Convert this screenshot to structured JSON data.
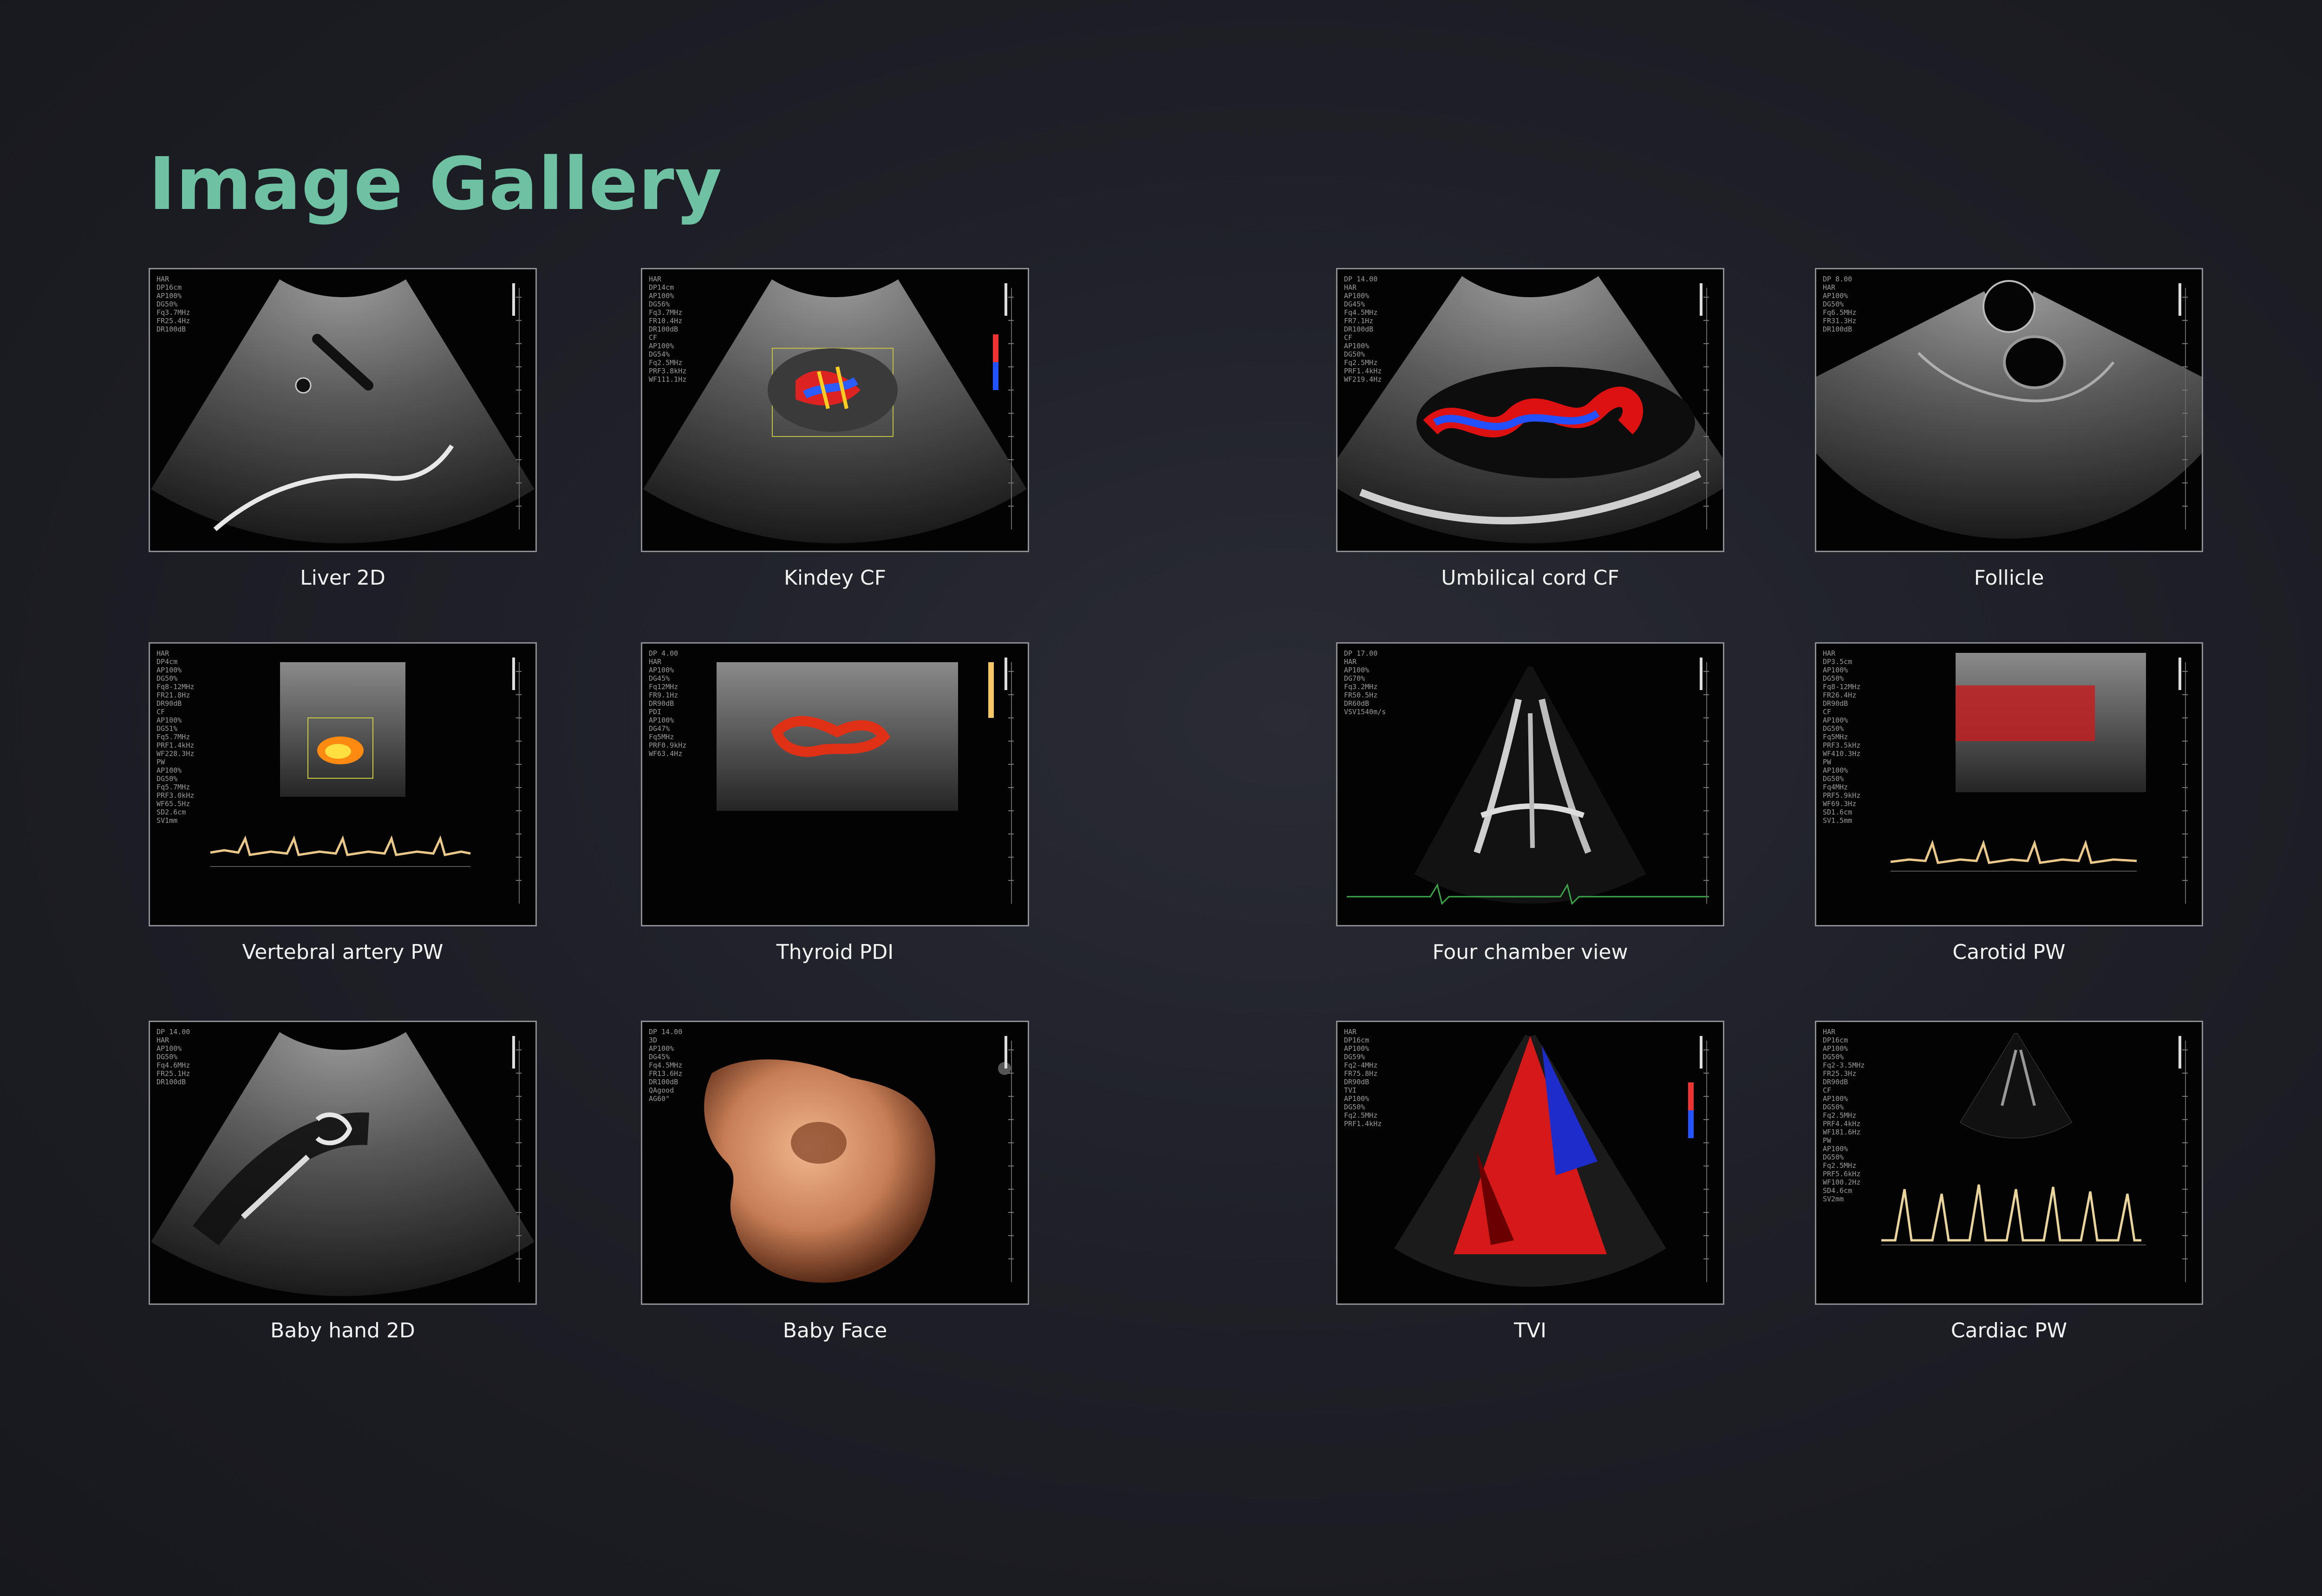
{
  "title": "Image Gallery",
  "colors": {
    "title": "#6fc1a3",
    "background": "#1f2027",
    "frame_border": "#8d8e93",
    "caption": "#f2f2f2"
  },
  "gallery": [
    {
      "caption": "Liver 2D",
      "params": "HAR\nDP16cm\nAP100%\nDG50%\nFq3.7MHz\nFR25.4Hz\nDR100dB",
      "kind": "sector-liver"
    },
    {
      "caption": "Kindey CF",
      "params": "HAR\nDP14cm\nAP100%\nDG56%\nFq3.7MHz\nFR10.4Hz\nDR100dB\nCF\nAP100%\nDG54%\nFq2.5MHz\nPRF3.8kHz\nWF111.1Hz",
      "kind": "sector-color"
    },
    {
      "caption": "Umbilical cord CF",
      "params": "DP 14.00\nHAR\nAP100%\nDG45%\nFq4.5MHz\nFR7.1Hz\nDR100dB\nCF\nAP100%\nDG50%\nFq2.5MHz\nPRF1.4kHz\nWF219.4Hz",
      "kind": "sector-cord"
    },
    {
      "caption": "Follicle",
      "params": "DP 8.00\nHAR\nAP100%\nDG50%\nFq6.5MHz\nFR31.3Hz\nDR100dB",
      "kind": "follicle"
    },
    {
      "caption": "Vertebral artery PW",
      "params": "HAR\nDP4cm\nAP100%\nDG50%\nFq8-12MHz\nFR21.8Hz\nDR90dB\nCF\nAP100%\nDG51%\nFq5.7MHz\nPRF1.4kHz\nWF228.3Hz\nPW\nAP100%\nDG50%\nFq5.7MHz\nPRF3.0kHz\nWF65.5Hz\nSD2.6cm\nSV1mm",
      "kind": "pw-linear"
    },
    {
      "caption": "Thyroid PDI",
      "params": "DP 4.00\nHAR\nAP100%\nDG45%\nFq12MHz\nFR9.1Hz\nDR90dB\nPDI\nAP100%\nDG47%\nFq5MHz\nPRF0.9kHz\nWF63.4Hz",
      "kind": "thyroid"
    },
    {
      "caption": "Four chamber view",
      "params": "DP 17.00\nHAR\nAP100%\nDG70%\nFq3.2MHz\nFR50.5Hz\nDR60dB\nVSV1540m/s",
      "kind": "cardiac"
    },
    {
      "caption": "Carotid PW",
      "params": "HAR\nDP3.5cm\nAP100%\nDG50%\nFq8-12MHz\nFR26.4Hz\nDR90dB\nCF\nAP100%\nDG50%\nFq5MHz\nPRF3.5kHz\nWF410.3Hz\nPW\nAP100%\nDG50%\nFq4MHz\nPRF5.9kHz\nWF69.3Hz\nSD1.6cm\nSV1.5mm",
      "kind": "pw-carotid"
    },
    {
      "caption": "Baby hand 2D",
      "params": "DP 14.00\nHAR\nAP100%\nDG50%\nFq4.6MHz\nFR25.1Hz\nDR100dB",
      "kind": "sector-hand"
    },
    {
      "caption": "Baby Face",
      "params": "DP 14.00\n3D\nAP100%\nDG45%\nFq4.5MHz\nFR13.6Hz\nDR100dB\nQAgood\nAG60°",
      "kind": "face3d"
    },
    {
      "caption": "TVI",
      "params": "HAR\nDP16cm\nAP100%\nDG59%\nFq2-4MHz\nFR75.8Hz\nDR90dB\nTVI\nAP100%\nDG50%\nFq2.5MHz\nPRF1.4kHz",
      "kind": "tvi"
    },
    {
      "caption": "Cardiac PW",
      "params": "HAR\nDP16cm\nAP100%\nDG50%\nFq2-3.5MHz\nFR25.3Hz\nDR90dB\nCF\nAP100%\nDG50%\nFq2.5MHz\nPRF4.4kHz\nWF181.6Hz\nPW\nAP100%\nDG50%\nFq2.5MHz\nPRF5.6kHz\nWF100.2Hz\nSD4.6cm\nSV2mm",
      "kind": "pw-cardiac"
    }
  ]
}
